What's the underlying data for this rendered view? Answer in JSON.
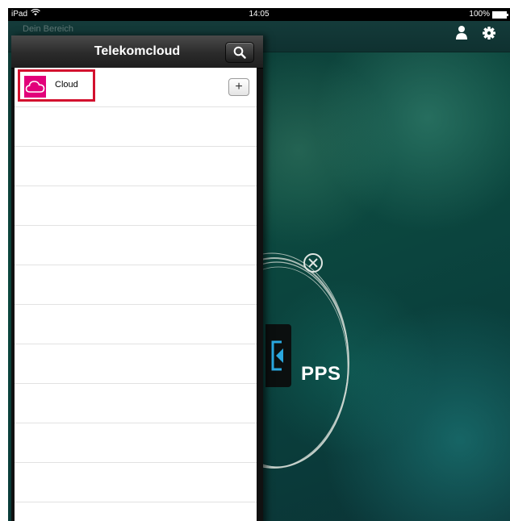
{
  "status_bar": {
    "device": "iPad",
    "time": "14:05",
    "battery": "100%",
    "battery_level": 1.0
  },
  "app_bar": {
    "title": "Dein Bereich"
  },
  "background": {
    "center_text": "PPS"
  },
  "popover": {
    "title": "Telekomcloud",
    "items": [
      {
        "label": "Cloud",
        "icon": "cloud-icon"
      }
    ],
    "empty_rows": 10
  },
  "colors": {
    "brand_magenta": "#e2007a",
    "highlight_red": "#d3112e",
    "accent_blue": "#2aa8e0"
  },
  "icons": [
    "wifi-icon",
    "person-icon",
    "gear-icon",
    "search-icon",
    "cloud-icon",
    "plus-icon",
    "close-circle-icon",
    "collapse-arrow-icon"
  ]
}
